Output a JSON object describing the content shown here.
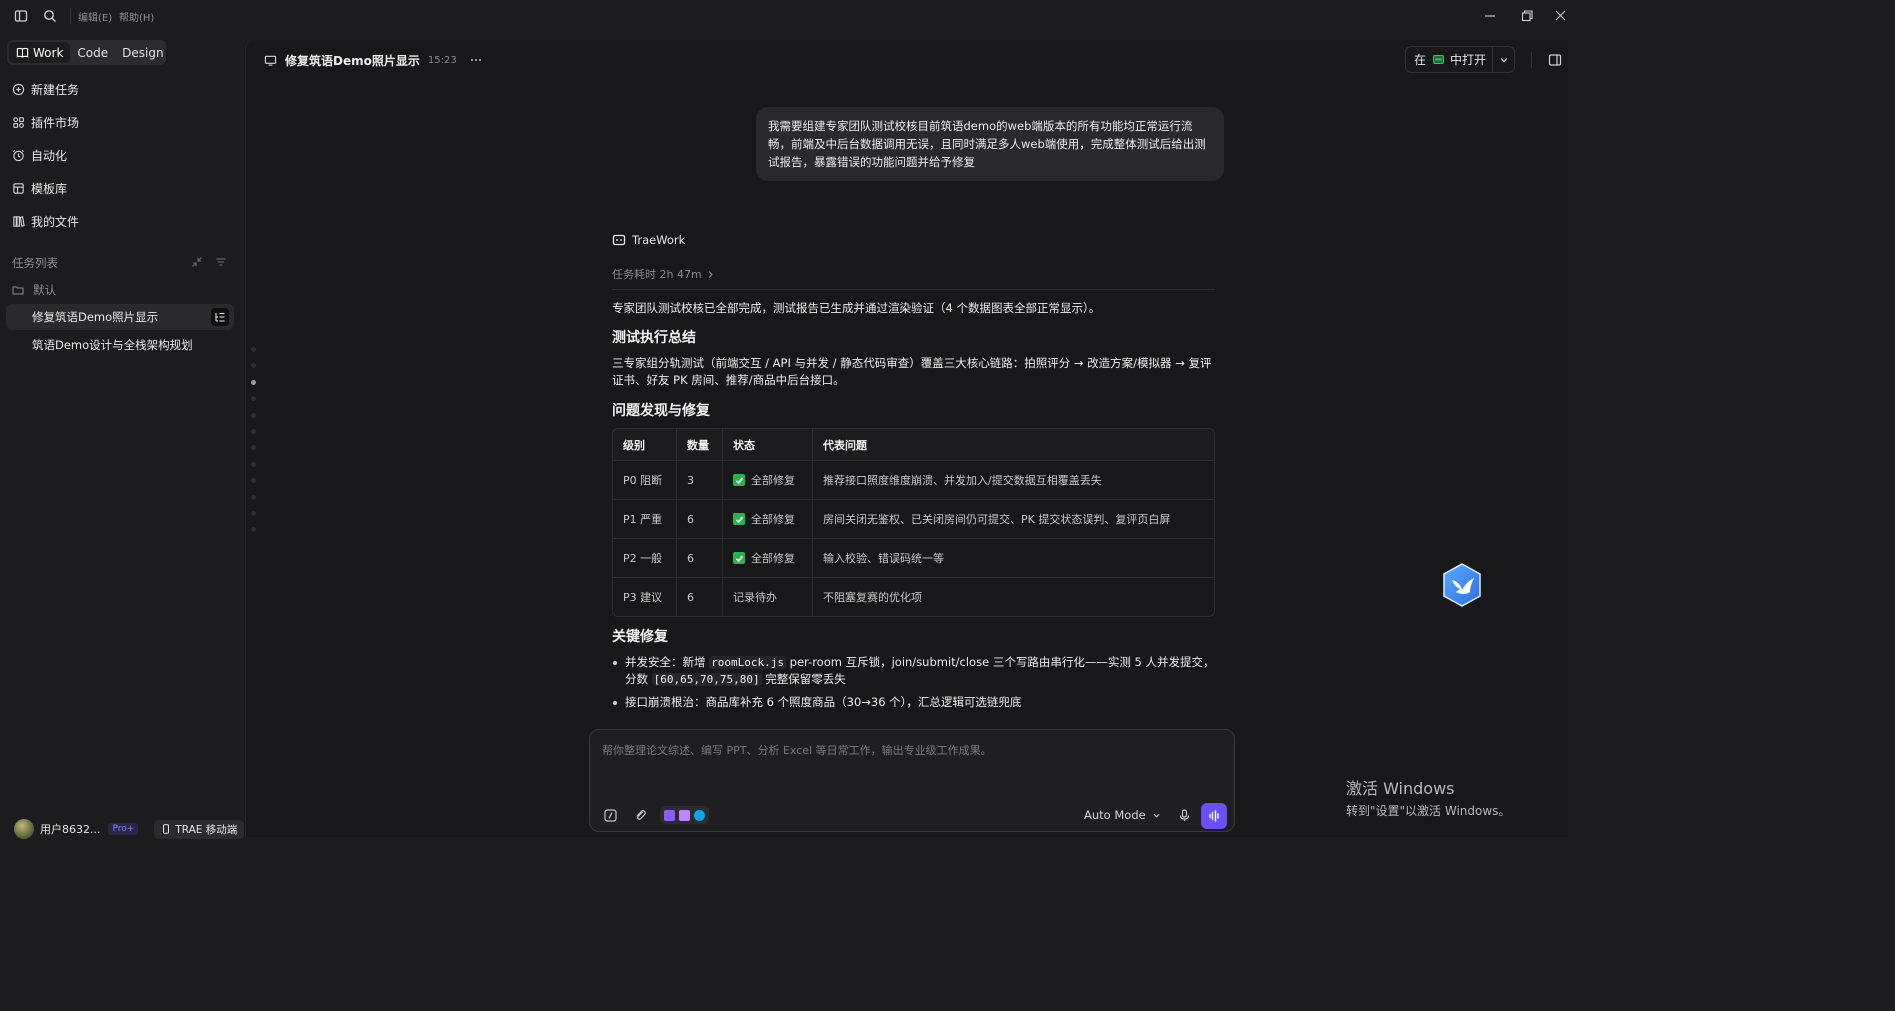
{
  "menu": {
    "edit": "编辑(E)",
    "help": "帮助(H)"
  },
  "modes": [
    {
      "label": "Work",
      "active": true
    },
    {
      "label": "Code",
      "active": false
    },
    {
      "label": "Design",
      "active": false
    }
  ],
  "nav": [
    {
      "label": "新建任务",
      "icon": "plus-circle-icon"
    },
    {
      "label": "插件市场",
      "icon": "plugin-grid-icon"
    },
    {
      "label": "自动化",
      "icon": "alarm-clock-icon"
    },
    {
      "label": "模板库",
      "icon": "template-icon"
    },
    {
      "label": "我的文件",
      "icon": "library-icon"
    }
  ],
  "task_list": {
    "header": "任务列表",
    "folder": "默认",
    "items": [
      {
        "label": "修复筑语Demo照片显示",
        "active": true
      },
      {
        "label": "筑语Demo设计与全栈架构规划",
        "active": false
      }
    ]
  },
  "user": {
    "name": "用户8632...",
    "badge": "Pro+",
    "mobile_label": "TRAE 移动端"
  },
  "chat": {
    "title": "修复筑语Demo照片显示",
    "time": "15:23"
  },
  "open_in": {
    "prefix": "在",
    "label": "中打开"
  },
  "user_message": "我需要组建专家团队测试校核目前筑语demo的web端版本的所有功能均正常运行流畅，前端及中后台数据调用无误，且同时满足多人web端使用，完成整体测试后给出测试报告，暴露错误的功能问题并给予修复",
  "assistant": {
    "name": "TraeWork",
    "duration": "任务耗时 2h 47m",
    "intro": "专家团队测试校核已全部完成，测试报告已生成并通过渲染验证（4 个数据图表全部正常显示）。",
    "section1_title": "测试执行总结",
    "section1_body": "三专家组分轨测试（前端交互 / API 与并发 / 静态代码审查）覆盖三大核心链路：拍照评分 → 改造方案/模拟器 → 复评证书、好友 PK 房间、推荐/商品中后台接口。",
    "section2_title": "问题发现与修复",
    "table": {
      "headers": [
        "级别",
        "数量",
        "状态",
        "代表问题"
      ],
      "rows": [
        {
          "level": "P0 阻断",
          "count": "3",
          "status": "全部修复",
          "checked": true,
          "issue": "推荐接口照度维度崩溃、并发加入/提交数据互相覆盖丢失"
        },
        {
          "level": "P1 严重",
          "count": "6",
          "status": "全部修复",
          "checked": true,
          "issue": "房间关闭无鉴权、已关闭房间仍可提交、PK 提交状态误判、复评页白屏"
        },
        {
          "level": "P2 一般",
          "count": "6",
          "status": "全部修复",
          "checked": true,
          "issue": "输入校验、错误码统一等"
        },
        {
          "level": "P3 建议",
          "count": "6",
          "status": "记录待办",
          "checked": false,
          "issue": "不阻塞复赛的优化项"
        }
      ]
    },
    "section3_title": "关键修复",
    "bullets": {
      "b1_pre": "并发安全：新增 ",
      "b1_code1": "roomLock.js",
      "b1_mid": " per-room 互斥锁，join/submit/close 三个写路由串行化——实测 5 人并发提交，分数 ",
      "b1_code2": "[60,65,70,75,80]",
      "b1_post": " 完整保留零丢失",
      "b2": "接口崩溃根治：商品库补充 6 个照度商品（30→36 个），汇总逻辑可选链兜底"
    }
  },
  "composer": {
    "placeholder": "帮你整理论文综述、编写 PPT、分析 Excel 等日常工作，输出专业级工作成果。",
    "mode": "Auto Mode"
  },
  "watermark": {
    "line1": "激活 Windows",
    "line2": "转到\"设置\"以激活 Windows。"
  },
  "colors": {
    "accent": "#6b4ef6",
    "check": "#2bb24c",
    "background": "#1c1c1e"
  }
}
